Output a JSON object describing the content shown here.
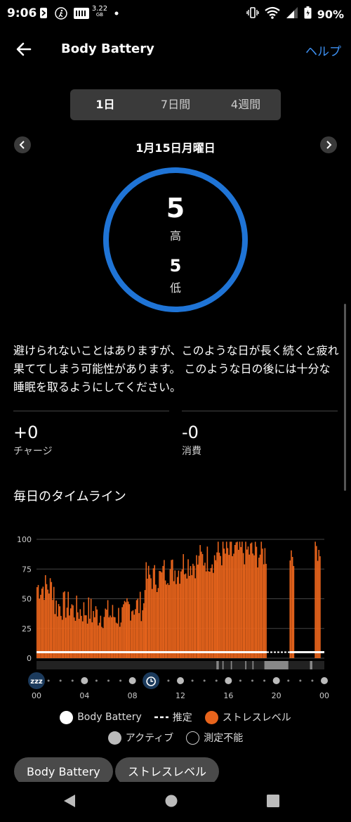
{
  "status_bar": {
    "time": "9:06",
    "data_usage": "3.22",
    "data_unit": "GB",
    "battery": "90%"
  },
  "header": {
    "title": "Body Battery",
    "help": "ヘルプ"
  },
  "tabs": [
    {
      "label": "1日",
      "active": true
    },
    {
      "label": "7日間",
      "active": false
    },
    {
      "label": "4週間",
      "active": false
    }
  ],
  "date": "1月15日月曜日",
  "summary": {
    "high_value": "5",
    "high_label": "高",
    "low_value": "5",
    "low_label": "低",
    "ring_color": "#1f74d6"
  },
  "description": "避けられないことはありますが、このような日が長く続くと疲れ果ててしまう可能性があります。 このような日の後には十分な睡眠を取るようにしてください。",
  "stats": {
    "charge_value": "+0",
    "charge_label": "チャージ",
    "drain_value": "-0",
    "drain_label": "消費"
  },
  "timeline_title": "毎日のタイムライン",
  "chart_data": {
    "type": "bar",
    "ylim": [
      0,
      100
    ],
    "yticks": [
      "100",
      "75",
      "50",
      "25",
      "0"
    ],
    "xticks": [
      "00",
      "04",
      "08",
      "12",
      "16",
      "20",
      "00"
    ],
    "body_battery_value": 5,
    "stress_color": "#e8641c",
    "stress_segments": [
      {
        "from": 0.0,
        "to": 1.5,
        "level": 60
      },
      {
        "from": 1.5,
        "to": 3.0,
        "level": 44
      },
      {
        "from": 3.0,
        "to": 4.5,
        "level": 40
      },
      {
        "from": 4.5,
        "to": 6.0,
        "level": 37
      },
      {
        "from": 6.0,
        "to": 7.5,
        "level": 36
      },
      {
        "from": 7.5,
        "to": 9.0,
        "level": 44
      },
      {
        "from": 9.0,
        "to": 10.5,
        "level": 68
      },
      {
        "from": 10.5,
        "to": 12.0,
        "level": 74
      },
      {
        "from": 12.0,
        "to": 13.5,
        "level": 80
      },
      {
        "from": 13.5,
        "to": 15.0,
        "level": 84
      },
      {
        "from": 15.0,
        "to": 16.5,
        "level": 88
      },
      {
        "from": 16.5,
        "to": 18.0,
        "level": 90
      },
      {
        "from": 18.0,
        "to": 19.2,
        "level": 88
      },
      {
        "from": 21.1,
        "to": 21.5,
        "level": 90
      },
      {
        "from": 23.2,
        "to": 23.7,
        "level": 94
      }
    ]
  },
  "legend": {
    "body_battery": "Body Battery",
    "estimate": "推定",
    "stress": "ストレスレベル",
    "active": "アクティブ",
    "unmeasurable": "測定不能"
  },
  "chips": [
    "Body Battery",
    "ストレスレベル"
  ]
}
